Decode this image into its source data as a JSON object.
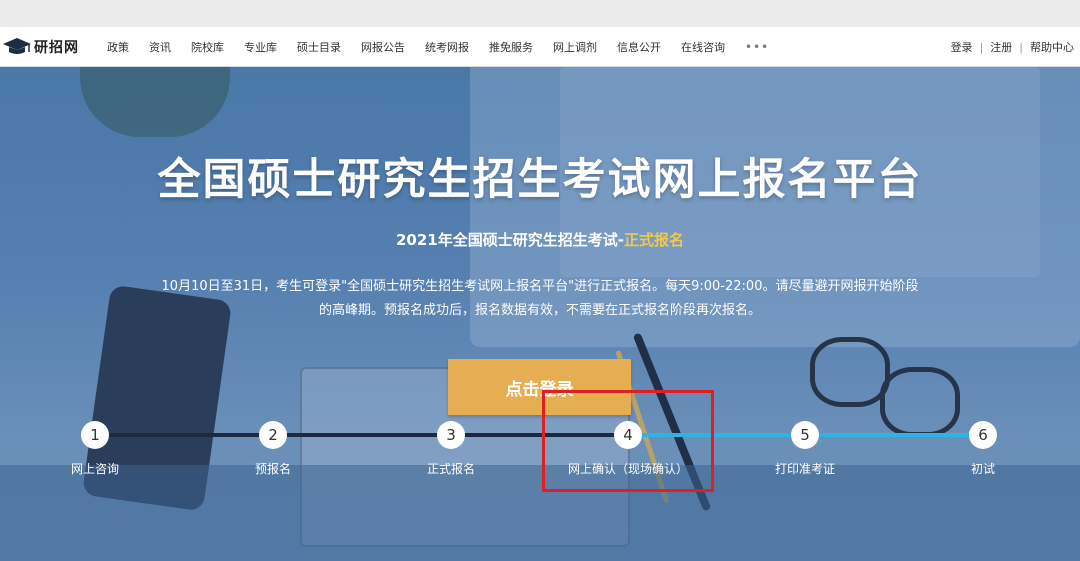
{
  "logo": {
    "text": "研招网",
    "icon": "graduation-cap-icon"
  },
  "nav": {
    "items": [
      "政策",
      "资讯",
      "院校库",
      "专业库",
      "硕士目录",
      "网报公告",
      "统考网报",
      "推免服务",
      "网上调剂",
      "信息公开",
      "在线咨询"
    ],
    "more": "•••",
    "login": "登录",
    "register": "注册",
    "help": "帮助中心",
    "separator": "|"
  },
  "hero": {
    "title": "全国硕士研究生招生考试网上报名平台",
    "subtitle_prefix": "2021年全国硕士研究生招生考试-",
    "subtitle_highlight": "正式报名",
    "description_line1": "10月10日至31日，考生可登录\"全国硕士研究生招生考试网上报名平台\"进行正式报名。每天9:00-22:00。请尽量避开网报开始阶段",
    "description_line2": "的高峰期。预报名成功后，报名数据有效，不需要在正式报名阶段再次报名。",
    "login_button": "点击登录"
  },
  "steps": [
    {
      "number": "1",
      "label": "网上咨询"
    },
    {
      "number": "2",
      "label": "预报名"
    },
    {
      "number": "3",
      "label": "正式报名"
    },
    {
      "number": "4",
      "label": "网上确认（现场确认）"
    },
    {
      "number": "5",
      "label": "打印准考证"
    },
    {
      "number": "6",
      "label": "初试"
    }
  ],
  "current_step": 4,
  "colors": {
    "accent": "#e6ae52",
    "highlight_text": "#f4c94a",
    "progress_done": "#1c2940",
    "progress_pending": "#2cb4e6",
    "annotation_box": "#e02020"
  }
}
